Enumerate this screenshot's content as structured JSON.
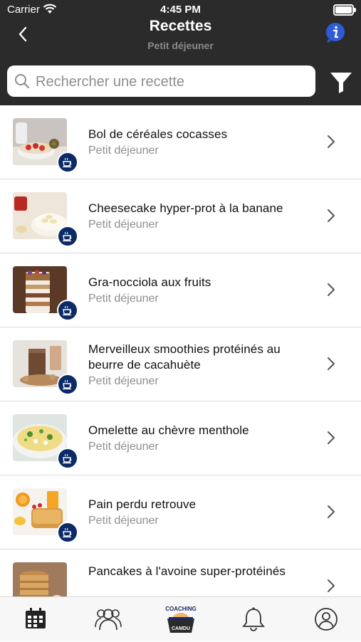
{
  "status_bar": {
    "carrier": "Carrier",
    "time": "4:45 PM"
  },
  "nav": {
    "title": "Recettes",
    "subtitle": "Petit déjeuner"
  },
  "search": {
    "placeholder": "Rechercher une recette",
    "value": ""
  },
  "recipes": [
    {
      "title": "Bol de céréales cocasses",
      "category": "Petit déjeuner"
    },
    {
      "title": "Cheesecake hyper-prot à la banane",
      "category": "Petit déjeuner"
    },
    {
      "title": "Gra-nocciola aux fruits",
      "category": "Petit déjeuner"
    },
    {
      "title": "Merveilleux smoothies protéinés au beurre de cacahuète",
      "category": "Petit déjeuner"
    },
    {
      "title": "Omelette au chèvre menthole",
      "category": "Petit déjeuner"
    },
    {
      "title": "Pain perdu retrouve",
      "category": "Petit déjeuner"
    },
    {
      "title": "Pancakes à l'avoine super-protéinés",
      "category": ""
    }
  ],
  "tabbar": {
    "items": [
      "calendar-icon",
      "community-icon",
      "coaching-logo",
      "bell-icon",
      "profile-icon"
    ],
    "logo_top": "COACHING",
    "logo_bottom": "CAMDU"
  },
  "colors": {
    "header": "#2b2b2b",
    "badge": "#0b2a66",
    "info": "#2f5bd6",
    "subtitle": "#8e8e93"
  }
}
